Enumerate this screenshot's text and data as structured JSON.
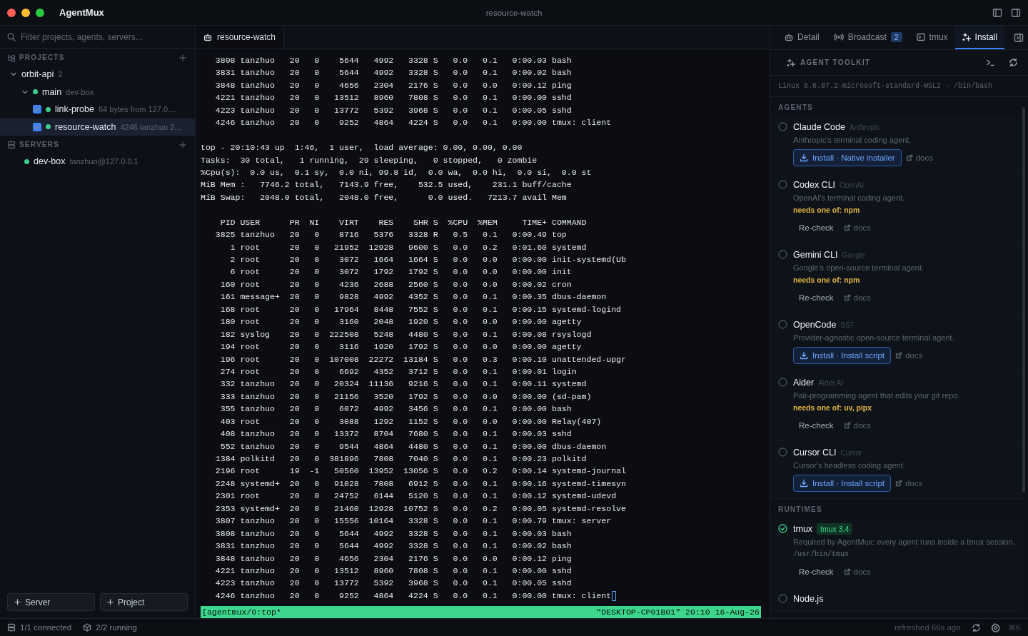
{
  "window": {
    "app_name": "AgentMux",
    "title": "resource-watch"
  },
  "sidebar": {
    "search": {
      "placeholder": "Filter projects, agents, servers..."
    },
    "projects": {
      "heading": "PROJECTS",
      "items": [
        {
          "name": "orbit-api",
          "count": "2",
          "expanded": true,
          "children": [
            {
              "name": "main",
              "host": "dev-box",
              "color": "#3ecf8e",
              "expanded": true,
              "children": [
                {
                  "name": "link-probe",
                  "preview": "64 bytes from 127.0....",
                  "checked": true,
                  "selected": false,
                  "color": "#3ecf8e"
                },
                {
                  "name": "resource-watch",
                  "preview": "4246 tanzhuo 2...",
                  "checked": true,
                  "selected": true,
                  "color": "#3ecf8e"
                }
              ]
            }
          ]
        }
      ]
    },
    "servers": {
      "heading": "SERVERS",
      "items": [
        {
          "name": "dev-box",
          "address": "tanzhuo@127.0.0.1",
          "color": "#3ecf8e"
        }
      ]
    },
    "buttons": [
      {
        "label": "Server"
      },
      {
        "label": "Project"
      }
    ]
  },
  "terminal": {
    "tab": "resource-watch",
    "cursor": true,
    "blocks": [
      [
        "   3808 tanzhuo   20   0    5644   4992   3328 S   0.0   0.1   0:00.03 bash",
        "   3831 tanzhuo   20   0    5644   4992   3328 S   0.0   0.1   0:00.02 bash",
        "   3848 tanzhuo   20   0    4656   2304   2176 S   0.0   0.0   0:00.12 ping",
        "   4221 tanzhuo   20   0   13512   8960   7808 S   0.0   0.1   0:00.00 sshd",
        "   4223 tanzhuo   20   0   13772   5392   3968 S   0.0   0.1   0:00.05 sshd",
        "   4246 tanzhuo   20   0    9252   4864   4224 S   0.0   0.1   0:00.00 tmux: client"
      ],
      [
        "top - 20:10:43 up  1:46,  1 user,  load average: 0.00, 0.00, 0.00",
        "Tasks:  30 total,   1 running,  29 sleeping,   0 stopped,   0 zombie",
        "%Cpu(s):  0.0 us,  0.1 sy,  0.0 ni, 99.8 id,  0.0 wa,  0.0 hi,  0.0 si,  0.0 st",
        "MiB Mem :   7746.2 total,   7143.9 free,    532.5 used,    231.1 buff/cache",
        "MiB Swap:   2048.0 total,   2048.0 free,      0.0 used.   7213.7 avail Mem"
      ],
      [
        "    PID USER      PR  NI    VIRT    RES    SHR S  %CPU  %MEM     TIME+ COMMAND",
        "   3825 tanzhuo   20   0    8716   5376   3328 R   0.5   0.1   0:00.49 top",
        "      1 root      20   0   21952  12928   9600 S   0.0   0.2   0:01.60 systemd",
        "      2 root      20   0    3072   1664   1664 S   0.0   0.0   0:00.00 init-systemd(Ub",
        "      6 root      20   0    3072   1792   1792 S   0.0   0.0   0:00.00 init",
        "    160 root      20   0    4236   2688   2560 S   0.0   0.0   0:00.02 cron",
        "    161 message+  20   0    9828   4992   4352 S   0.0   0.1   0:00.35 dbus-daemon",
        "    168 root      20   0   17964   8448   7552 S   0.0   0.1   0:00.15 systemd-logind",
        "    180 root      20   0    3160   2048   1920 S   0.0   0.0   0:00.00 agetty",
        "    182 syslog    20   0  222508   5248   4480 S   0.0   0.1   0:00.08 rsyslogd",
        "    194 root      20   0    3116   1920   1792 S   0.0   0.0   0:00.00 agetty",
        "    196 root      20   0  107008  22272  13184 S   0.0   0.3   0:00.10 unattended-upgr",
        "    274 root      20   0    6692   4352   3712 S   0.0   0.1   0:00.01 login",
        "    332 tanzhuo   20   0   20324  11136   9216 S   0.0   0.1   0:00.11 systemd",
        "    333 tanzhuo   20   0   21156   3520   1792 S   0.0   0.0   0:00.00 (sd-pam)",
        "    355 tanzhuo   20   0    6072   4992   3456 S   0.0   0.1   0:00.00 bash",
        "    403 root      20   0    3088   1292   1152 S   0.0   0.0   0:00.00 Relay(407)",
        "    408 tanzhuo   20   0   13372   8704   7680 S   0.0   0.1   0:00.03 sshd",
        "    552 tanzhuo   20   0    9544   4864   4480 S   0.0   0.1   0:00.00 dbus-daemon",
        "   1384 polkitd   20   0  381896   7808   7040 S   0.0   0.1   0:00.23 polkitd",
        "   2196 root      19  -1   50560  13952  13056 S   0.0   0.2   0:00.14 systemd-journal",
        "   2248 systemd+  20   0   91028   7808   6912 S   0.0   0.1   0:00.16 systemd-timesyn",
        "   2301 root      20   0   24752   6144   5120 S   0.0   0.1   0:00.12 systemd-udevd",
        "   2353 systemd+  20   0   21460  12928  10752 S   0.0   0.2   0:00.05 systemd-resolve",
        "   3807 tanzhuo   20   0   15556  10164   3328 S   0.0   0.1   0:00.79 tmux: server",
        "   3808 tanzhuo   20   0    5644   4992   3328 S   0.0   0.1   0:00.03 bash",
        "   3831 tanzhuo   20   0    5644   4992   3328 S   0.0   0.1   0:00.02 bash",
        "   3848 tanzhuo   20   0    4656   2304   2176 S   0.0   0.0   0:00.12 ping",
        "   4221 tanzhuo   20   0   13512   8960   7808 S   0.0   0.1   0:00.00 sshd",
        "   4223 tanzhuo   20   0   13772   5392   3968 S   0.0   0.1   0:00.05 sshd",
        "   4246 tanzhuo   20   0    9252   4864   4224 S   0.0   0.1   0:00.00 tmux: client"
      ]
    ],
    "status_left": "[agentmux/0:top*",
    "status_right": "\"DESKTOP-CP01B01\" 20:10 16-Aug-26"
  },
  "panel": {
    "tabs": [
      {
        "label": "Detail",
        "selected": false
      },
      {
        "label": "Broadcast",
        "badge": "2",
        "selected": false
      },
      {
        "label": "tmux",
        "selected": false
      },
      {
        "label": "Install",
        "selected": true
      }
    ],
    "toolkit": {
      "heading": "AGENT TOOLKIT",
      "system": "Linux 6.6.87.2-microsoft-standard-WSL2 · /bin/bash"
    },
    "sections": [
      {
        "heading": "AGENTS",
        "items": [
          {
            "name": "Claude Code",
            "vendor": "Anthropic",
            "description": "Anthropic's terminal coding agent.",
            "installed": false,
            "actions": [
              {
                "kind": "install",
                "label": "Install · Native installer"
              },
              {
                "kind": "docs",
                "label": "docs"
              }
            ]
          },
          {
            "name": "Codex CLI",
            "vendor": "OpenAI",
            "description": "OpenAI's terminal coding agent.",
            "installed": false,
            "needs": "needs one of: npm",
            "actions": [
              {
                "kind": "recheck",
                "label": "Re-check"
              },
              {
                "kind": "docs",
                "label": "docs"
              }
            ]
          },
          {
            "name": "Gemini CLI",
            "vendor": "Google",
            "description": "Google's open-source terminal agent.",
            "installed": false,
            "needs": "needs one of: npm",
            "actions": [
              {
                "kind": "recheck",
                "label": "Re-check"
              },
              {
                "kind": "docs",
                "label": "docs"
              }
            ]
          },
          {
            "name": "OpenCode",
            "vendor": "SST",
            "description": "Provider-agnostic open-source terminal agent.",
            "installed": false,
            "actions": [
              {
                "kind": "install",
                "label": "Install · Install script"
              },
              {
                "kind": "docs",
                "label": "docs"
              }
            ]
          },
          {
            "name": "Aider",
            "vendor": "Aider AI",
            "description": "Pair-programming agent that edits your git repo.",
            "installed": false,
            "needs": "needs one of: uv, pipx",
            "actions": [
              {
                "kind": "recheck",
                "label": "Re-check"
              },
              {
                "kind": "docs",
                "label": "docs"
              }
            ]
          },
          {
            "name": "Cursor CLI",
            "vendor": "Cursor",
            "description": "Cursor's headless coding agent.",
            "installed": false,
            "actions": [
              {
                "kind": "install",
                "label": "Install · Install script"
              },
              {
                "kind": "docs",
                "label": "docs"
              }
            ]
          }
        ]
      },
      {
        "heading": "RUNTIMES",
        "items": [
          {
            "name": "tmux",
            "version": "tmux 3.4",
            "description": "Required by AgentMux: every agent runs inside a tmux session.",
            "path": "/usr/bin/tmux",
            "installed": true,
            "actions": [
              {
                "kind": "recheck",
                "label": "Re-check"
              },
              {
                "kind": "docs",
                "label": "docs"
              }
            ]
          },
          {
            "name": "Node.js",
            "installed": false
          }
        ]
      }
    ]
  },
  "status_bar": {
    "connected": "1/1 connected",
    "running": "2/2 running",
    "refreshed": "refreshed 66s ago",
    "shortcut": "⌘K"
  }
}
